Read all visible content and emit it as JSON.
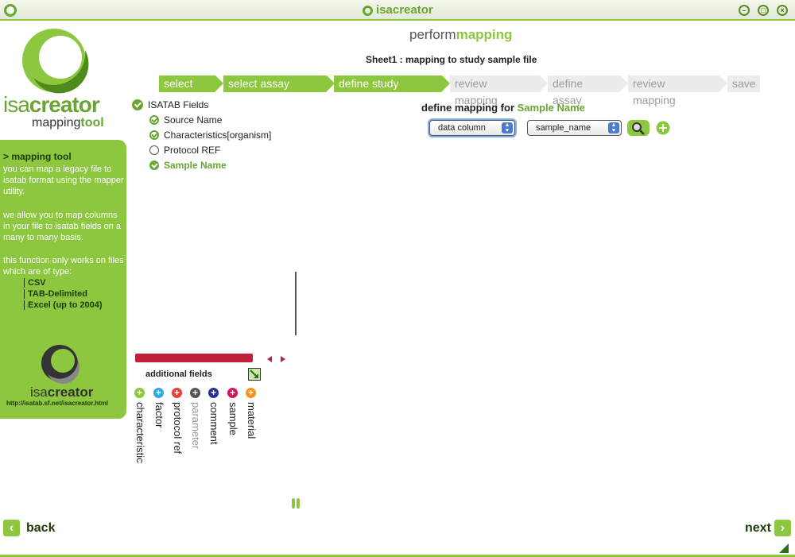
{
  "window": {
    "title": "isacreator",
    "controls": [
      "minimize",
      "restore",
      "close"
    ]
  },
  "left_panel": {
    "logo_text_a": "isa",
    "logo_text_b": "creator",
    "logo_sub_a": "mapping",
    "logo_sub_b": "tool",
    "sidebar_title": "> mapping tool",
    "sidebar_p1": "you can map a legacy file to isatab format using the mapper utility.",
    "sidebar_p2": "we allow you to map columns in your file to isatab fields on a many to many basis.",
    "sidebar_p3": "this function only works on files which are of type:",
    "file_types": [
      "CSV",
      "TAB-Delimited",
      "Excel (up to 2004)"
    ],
    "small_logo_a": "isa",
    "small_logo_b": "creator",
    "url": "http://isatab.sf.net/isacreator.html"
  },
  "header": {
    "title_a": "perform",
    "title_b": "mapping",
    "subtitle": "Sheet1 : mapping to study sample file"
  },
  "steps": [
    {
      "label": "select file",
      "state": "done"
    },
    {
      "label": "select assay type(s)",
      "state": "done"
    },
    {
      "label": "define study sample",
      "state": "done"
    },
    {
      "label": "review mapping",
      "state": "todo"
    },
    {
      "label": "define assay",
      "state": "todo"
    },
    {
      "label": "review mapping",
      "state": "todo"
    },
    {
      "label": "save",
      "state": "todo"
    }
  ],
  "tree": {
    "root": "ISATAB Fields",
    "items": [
      {
        "label": "Source Name",
        "state": "checked"
      },
      {
        "label": "Characteristics[organism]",
        "state": "checked"
      },
      {
        "label": "Protocol REF",
        "state": "unchecked"
      },
      {
        "label": "Sample Name",
        "state": "selected"
      }
    ]
  },
  "mapping": {
    "label": "define mapping for",
    "field": "Sample Name",
    "type_value": "data column",
    "column_value": "sample_name"
  },
  "additional": {
    "label": "additional fields",
    "fields": [
      {
        "label": "characteristic",
        "color": "#8dc63f"
      },
      {
        "label": "factor",
        "color": "#29abe2"
      },
      {
        "label": "protocol ref",
        "color": "#e8413c"
      },
      {
        "label": "parameter",
        "color": "#555555"
      },
      {
        "label": "comment",
        "color": "#2e3192"
      },
      {
        "label": "sample",
        "color": "#d4145a"
      },
      {
        "label": "material",
        "color": "#f7931e"
      }
    ]
  },
  "nav": {
    "back": "back",
    "next": "next"
  }
}
